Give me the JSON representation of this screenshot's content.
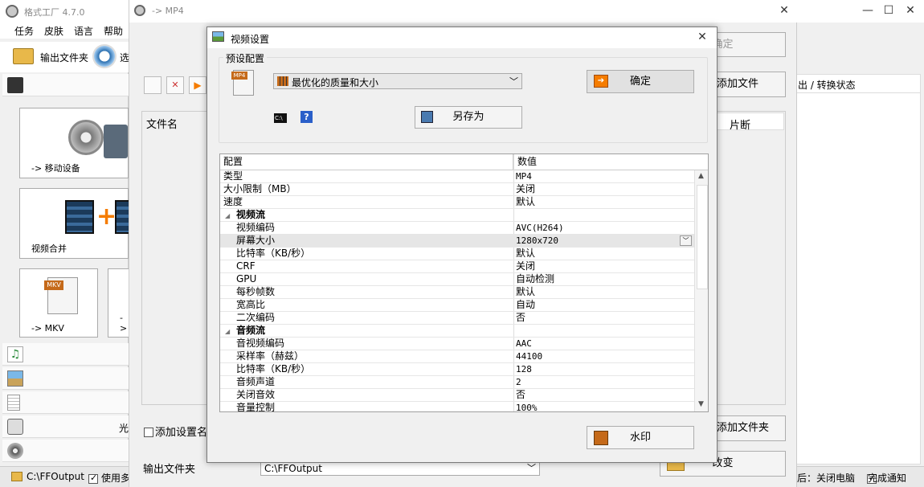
{
  "main_window": {
    "title": "格式工厂 4.7.0",
    "menu": [
      "任务",
      "皮肤",
      "语言",
      "帮助"
    ],
    "toolbar": {
      "output_folder": "输出文件夹",
      "options_partial": "选"
    },
    "tiles": [
      {
        "label": "-> 移动设备"
      },
      {
        "label": "视频合并"
      },
      {
        "label": "-> MKV"
      },
      {
        "label": "->"
      }
    ],
    "optical_partial": "光",
    "status": {
      "output_path": "C:\\FFOutput",
      "use_partial": "使用多",
      "after_partial": "后：关闭电脑",
      "notify": "完成通知"
    },
    "right_header_partial": "出 / 转换状态"
  },
  "mp4_window": {
    "title": "-> MP4",
    "ok_button": "确定",
    "add_file": "添加文件",
    "col_filename": "文件名",
    "col_clip": "片断",
    "add_setting_name": "添加设置名称",
    "add_folder": "添加文件夹",
    "output_folder_label": "输出文件夹",
    "output_folder_value": "C:\\FFOutput",
    "change_button": "改变"
  },
  "dialog": {
    "title": "视频设置",
    "preset_group": "预设配置",
    "preset_value": "最优化的质量和大小",
    "ok": "确定",
    "save_as": "另存为",
    "watermark": "水印",
    "grid_header": {
      "config": "配置",
      "value": "数值"
    },
    "rows": [
      {
        "k": "类型",
        "v": "MP4"
      },
      {
        "k": "大小限制（MB）",
        "v": "关闭"
      },
      {
        "k": "速度",
        "v": "默认"
      },
      {
        "k": "视频流",
        "v": ""
      },
      {
        "k": "视频编码",
        "v": "AVC(H264)"
      },
      {
        "k": "屏幕大小",
        "v": "1280x720"
      },
      {
        "k": "比特率（KB/秒）",
        "v": "默认"
      },
      {
        "k": "CRF",
        "v": "关闭"
      },
      {
        "k": "GPU",
        "v": "自动检测"
      },
      {
        "k": "每秒帧数",
        "v": "默认"
      },
      {
        "k": "宽高比",
        "v": "自动"
      },
      {
        "k": "二次编码",
        "v": "否"
      },
      {
        "k": "音频流",
        "v": ""
      },
      {
        "k": "音视频编码",
        "v": "AAC"
      },
      {
        "k": "采样率（赫兹）",
        "v": "44100"
      },
      {
        "k": "比特率（KB/秒）",
        "v": "128"
      },
      {
        "k": "音频声道",
        "v": "2"
      },
      {
        "k": "关闭音效",
        "v": "否"
      },
      {
        "k": "音量控制",
        "v": "100%"
      }
    ]
  },
  "colors": {
    "accent_orange": "#f57c00",
    "selected_row": "#e6e6e6"
  }
}
